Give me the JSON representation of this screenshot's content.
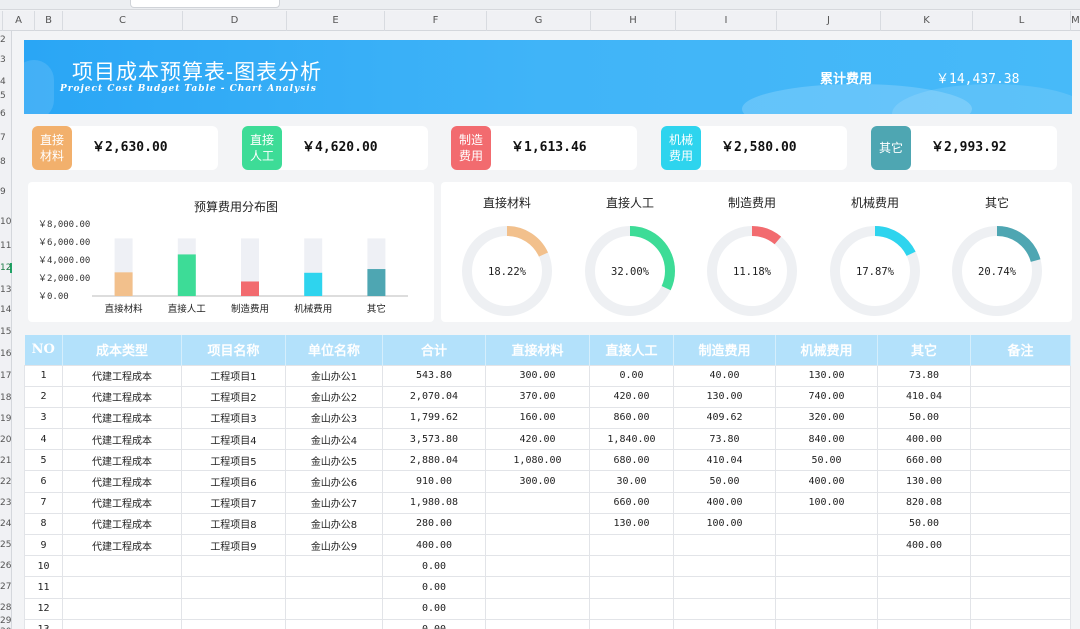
{
  "spreadsheet": {
    "columns": [
      "A",
      "B",
      "C",
      "D",
      "E",
      "F",
      "G",
      "H",
      "I",
      "J",
      "K",
      "L",
      "M"
    ],
    "rows": [
      "2",
      "3",
      "4",
      "5",
      "6",
      "7",
      "8",
      "9",
      "10",
      "11",
      "12",
      "13",
      "14",
      "15",
      "16",
      "17",
      "18",
      "19",
      "20",
      "21",
      "22",
      "23",
      "24",
      "25",
      "26",
      "27",
      "28",
      "29",
      "30"
    ]
  },
  "banner": {
    "title": "项目成本预算表-图表分析",
    "subtitle": "Project Cost Budget Table  -  Chart Analysis",
    "total_label": "累计费用",
    "total_value": "￥14,437.38"
  },
  "cards": [
    {
      "label": "直接材料",
      "value": "￥2,630.00",
      "color": "#f2b06c"
    },
    {
      "label": "直接人工",
      "value": "￥4,620.00",
      "color": "#3ddc97"
    },
    {
      "label": "制造费用",
      "value": "￥1,613.46",
      "color": "#f26b6f"
    },
    {
      "label": "机械费用",
      "value": "￥2,580.00",
      "color": "#2ed4ee"
    },
    {
      "label": "其它",
      "value": "￥2,993.92",
      "color": "#4ea6b2"
    }
  ],
  "chart_data": [
    {
      "type": "bar",
      "title": "预算费用分布图",
      "categories": [
        "直接材料",
        "直接人工",
        "制造费用",
        "机械费用",
        "其它"
      ],
      "values": [
        2630.0,
        4620.0,
        1613.46,
        2580.0,
        2993.92
      ],
      "colors": [
        "#f2c08c",
        "#3ddc97",
        "#f26b6f",
        "#2ed4ee",
        "#4ea6b2"
      ],
      "ylim": [
        0,
        8000
      ],
      "yticks": [
        "￥8,000.00",
        "￥6,000.00",
        "￥4,000.00",
        "￥2,000.00",
        "￥0.00"
      ],
      "background_bar_max": 6400
    },
    {
      "type": "pie",
      "subtype": "donut",
      "categories": [
        "直接材料",
        "直接人工",
        "制造费用",
        "机械费用",
        "其它"
      ],
      "values": [
        18.22,
        32.0,
        11.18,
        17.87,
        20.74
      ],
      "labels": [
        "18.22%",
        "32.00%",
        "11.18%",
        "17.87%",
        "20.74%"
      ],
      "colors": [
        "#f2c08c",
        "#3ddc97",
        "#f26b6f",
        "#2ed4ee",
        "#4ea6b2"
      ]
    }
  ],
  "table": {
    "headers": [
      "NO",
      "成本类型",
      "项目名称",
      "单位名称",
      "合计",
      "直接材料",
      "直接人工",
      "制造费用",
      "机械费用",
      "其它",
      "备注"
    ],
    "rows": [
      [
        "1",
        "代建工程成本",
        "工程项目1",
        "金山办公1",
        "543.80",
        "300.00",
        "0.00",
        "40.00",
        "130.00",
        "73.80",
        ""
      ],
      [
        "2",
        "代建工程成本",
        "工程项目2",
        "金山办公2",
        "2,070.04",
        "370.00",
        "420.00",
        "130.00",
        "740.00",
        "410.04",
        ""
      ],
      [
        "3",
        "代建工程成本",
        "工程项目3",
        "金山办公3",
        "1,799.62",
        "160.00",
        "860.00",
        "409.62",
        "320.00",
        "50.00",
        ""
      ],
      [
        "4",
        "代建工程成本",
        "工程项目4",
        "金山办公4",
        "3,573.80",
        "420.00",
        "1,840.00",
        "73.80",
        "840.00",
        "400.00",
        ""
      ],
      [
        "5",
        "代建工程成本",
        "工程项目5",
        "金山办公5",
        "2,880.04",
        "1,080.00",
        "680.00",
        "410.04",
        "50.00",
        "660.00",
        ""
      ],
      [
        "6",
        "代建工程成本",
        "工程项目6",
        "金山办公6",
        "910.00",
        "300.00",
        "30.00",
        "50.00",
        "400.00",
        "130.00",
        ""
      ],
      [
        "7",
        "代建工程成本",
        "工程项目7",
        "金山办公7",
        "1,980.08",
        "",
        "660.00",
        "400.00",
        "100.00",
        "820.08",
        ""
      ],
      [
        "8",
        "代建工程成本",
        "工程项目8",
        "金山办公8",
        "280.00",
        "",
        "130.00",
        "100.00",
        "",
        "50.00",
        ""
      ],
      [
        "9",
        "代建工程成本",
        "工程项目9",
        "金山办公9",
        "400.00",
        "",
        "",
        "",
        "",
        "400.00",
        ""
      ],
      [
        "10",
        "",
        "",
        "",
        "0.00",
        "",
        "",
        "",
        "",
        "",
        ""
      ],
      [
        "11",
        "",
        "",
        "",
        "0.00",
        "",
        "",
        "",
        "",
        "",
        ""
      ],
      [
        "12",
        "",
        "",
        "",
        "0.00",
        "",
        "",
        "",
        "",
        "",
        ""
      ],
      [
        "13",
        "",
        "",
        "",
        "0.00",
        "",
        "",
        "",
        "",
        "",
        ""
      ]
    ]
  }
}
